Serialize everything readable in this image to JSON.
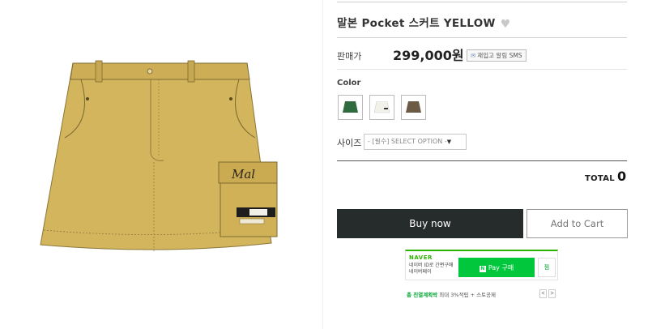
{
  "product": {
    "title": "말본 Pocket 스커트 YELLOW",
    "wish_icon": "heart-icon",
    "price_label": "판매가",
    "price": "299,000원",
    "restock_sms": "재입고 알림 SMS"
  },
  "options": {
    "color_label": "Color",
    "swatches": [
      {
        "name": "green",
        "color": "#2f6b3f"
      },
      {
        "name": "white",
        "color": "#f2f1ea"
      },
      {
        "name": "brown",
        "color": "#6b5a44"
      }
    ],
    "size_label": "사이즈",
    "size_placeholder": "- [필수] SELECT OPTION -"
  },
  "total": {
    "label": "TOTAL",
    "value": "0"
  },
  "actions": {
    "buy_now": "Buy now",
    "add_to_cart": "Add to Cart"
  },
  "naver_pay": {
    "logo": "NAVER",
    "description": "네이버 ID로 간편구매 네이버페이",
    "pay_button": "Pay 구매",
    "pay_badge": "N",
    "wish": "찜",
    "promo_highlight": "총 진열계획박",
    "promo_text": "최대 3%적립 + 스토공제",
    "prev": "<",
    "next": ">"
  },
  "colors": {
    "skirt_main": "#d3b55e",
    "buy_button": "#262b2c",
    "naver_green": "#00c73c"
  }
}
